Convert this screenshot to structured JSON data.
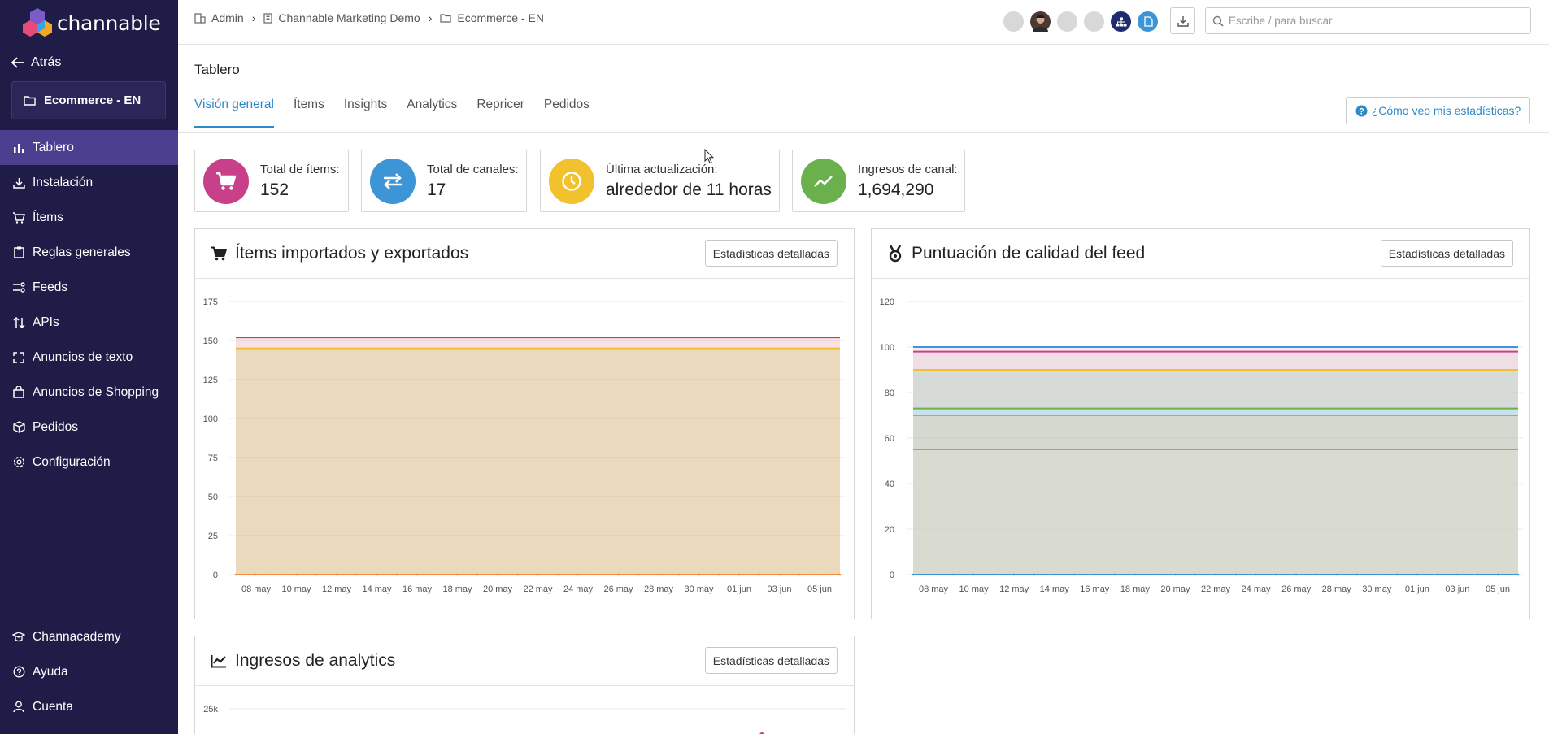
{
  "app": {
    "logo_text": "channable",
    "back_label": "Atrás",
    "project": "Ecommerce - EN"
  },
  "sidebar": {
    "items": [
      {
        "label": "Tablero",
        "icon": "bar-chart-icon",
        "active": true
      },
      {
        "label": "Instalación",
        "icon": "download-tray-icon",
        "active": false
      },
      {
        "label": "Ítems",
        "icon": "cart-icon",
        "active": false
      },
      {
        "label": "Reglas generales",
        "icon": "clipboard-icon",
        "active": false
      },
      {
        "label": "Feeds",
        "icon": "feed-icon",
        "active": false
      },
      {
        "label": "APIs",
        "icon": "sort-arrows-icon",
        "active": false
      },
      {
        "label": "Anuncios de texto",
        "icon": "frame-icon",
        "active": false
      },
      {
        "label": "Anuncios de Shopping",
        "icon": "shopping-bag-icon",
        "active": false
      },
      {
        "label": "Pedidos",
        "icon": "box-icon",
        "active": false
      },
      {
        "label": "Configuración",
        "icon": "gear-icon",
        "active": false
      }
    ],
    "bottom_items": [
      {
        "label": "Channacademy",
        "icon": "graduation-cap-icon"
      },
      {
        "label": "Ayuda",
        "icon": "question-icon"
      },
      {
        "label": "Cuenta",
        "icon": "user-icon"
      }
    ]
  },
  "breadcrumb": [
    "Admin",
    "Channable Marketing Demo",
    "Ecommerce - EN"
  ],
  "search": {
    "placeholder": "Escribe / para buscar",
    "value": ""
  },
  "page": {
    "title": "Tablero",
    "tabs": [
      "Visión general",
      "Ítems",
      "Insights",
      "Analytics",
      "Repricer",
      "Pedidos"
    ],
    "active_tab": "Visión general",
    "help_label": "¿Cómo veo mis estadísticas?"
  },
  "stats": [
    {
      "label": "Total de ítems:",
      "value": "152",
      "color": "#c9408a",
      "icon": "cart-icon"
    },
    {
      "label": "Total de canales:",
      "value": "17",
      "color": "#3d95d6",
      "icon": "swap-arrows-icon"
    },
    {
      "label": "Última actualización:",
      "value": "alrededor de 11 horas",
      "color": "#f2c12e",
      "icon": "clock-icon"
    },
    {
      "label": "Ingresos de canal:",
      "value": "1,694,290",
      "color": "#6ab04c",
      "icon": "trend-line-icon"
    }
  ],
  "panels": {
    "imported": {
      "title": "Ítems importados y exportados",
      "button": "Estadísticas detalladas"
    },
    "quality": {
      "title": "Puntuación de calidad del feed",
      "button": "Estadísticas detalladas"
    },
    "revenue": {
      "title": "Ingresos de analytics",
      "button": "Estadísticas detalladas"
    }
  },
  "chart_data": [
    {
      "type": "area",
      "x_ticks": [
        "08 may",
        "10 may",
        "12 may",
        "14 may",
        "16 may",
        "18 may",
        "20 may",
        "22 may",
        "24 may",
        "26 may",
        "28 may",
        "30 may",
        "01 jun",
        "03 jun",
        "05 jun"
      ],
      "y_ticks": [
        0,
        25,
        50,
        75,
        100,
        125,
        150,
        175
      ],
      "ylim": [
        0,
        175
      ],
      "series": [
        {
          "values": [
            152
          ],
          "color": "#d63b5a"
        },
        {
          "values": [
            145
          ],
          "color": "#f2c12e"
        },
        {
          "values": [
            0
          ],
          "color": "#f08a3c"
        }
      ]
    },
    {
      "type": "area",
      "x_ticks": [
        "08 may",
        "10 may",
        "12 may",
        "14 may",
        "16 may",
        "18 may",
        "20 may",
        "22 may",
        "24 may",
        "26 may",
        "28 may",
        "30 may",
        "01 jun",
        "03 jun",
        "05 jun"
      ],
      "y_ticks": [
        0,
        20,
        40,
        60,
        80,
        100,
        120
      ],
      "ylim": [
        0,
        120
      ],
      "series": [
        {
          "values": [
            100
          ],
          "color": "#3d95d6"
        },
        {
          "values": [
            98
          ],
          "color": "#c9408a"
        },
        {
          "values": [
            90
          ],
          "color": "#f2c12e"
        },
        {
          "values": [
            73
          ],
          "color": "#6ab04c"
        },
        {
          "values": [
            70
          ],
          "color": "#5bc0de"
        },
        {
          "values": [
            55
          ],
          "color": "#f08a3c"
        },
        {
          "values": [
            0
          ],
          "color": "#3d95d6"
        }
      ]
    },
    {
      "type": "line",
      "y_ticks": [
        "25k"
      ]
    }
  ]
}
